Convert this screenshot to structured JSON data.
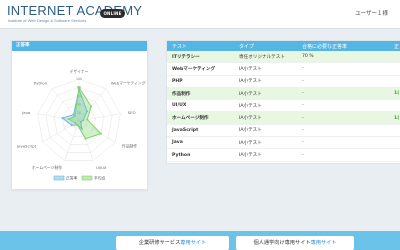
{
  "header": {
    "brand_title": "INTERNET ACADEMY",
    "brand_subtitle": "Institute of Web Design & Software Services",
    "badge": "ONLINE",
    "user": "ユーザー１様"
  },
  "chart_card": {
    "title": "正答率",
    "legend": [
      {
        "label": "正答率",
        "color": "#6fb7e0"
      },
      {
        "label": "平均点",
        "color": "#7fd36a"
      }
    ]
  },
  "chart_data": {
    "type": "radar",
    "axes": [
      "デザイナー",
      "Webマーケティング",
      "SEO",
      "作品制作",
      "UI/UX",
      "ホームページ制作",
      "JavaScript",
      "Java",
      "Python"
    ],
    "ticks": [
      "100",
      "80",
      "60",
      "40",
      "20"
    ],
    "series": [
      {
        "name": "正答率",
        "color": "#6fb7e0",
        "values": [
          75,
          30,
          10,
          5,
          20,
          10,
          20,
          40,
          20
        ]
      },
      {
        "name": "平均点",
        "color": "#7fd36a",
        "values": [
          80,
          45,
          20,
          60,
          45,
          10,
          10,
          25,
          15
        ]
      }
    ]
  },
  "table": {
    "headers": [
      "テスト",
      "タイプ",
      "合格に必要な正答率",
      "正"
    ],
    "rows": [
      {
        "name": "ITリテラシー",
        "type": "専任オリジナルテスト",
        "required": "70 %",
        "extra": "",
        "highlight": true
      },
      {
        "name": "Webマーケティング",
        "type": "IA小テスト",
        "required": "-",
        "extra": "",
        "highlight": false
      },
      {
        "name": "PHP",
        "type": "IA小テスト",
        "required": "-",
        "extra": "",
        "highlight": false
      },
      {
        "name": "作品制作",
        "type": "IA小テスト",
        "required": "-",
        "extra": "1(",
        "highlight": true
      },
      {
        "name": "UI/UX",
        "type": "IA小テスト",
        "required": "-",
        "extra": "",
        "highlight": false
      },
      {
        "name": "ホームページ制作",
        "type": "IA小テスト",
        "required": "-",
        "extra": "1(",
        "highlight": true
      },
      {
        "name": "JavaScript",
        "type": "IA小テスト",
        "required": "-",
        "extra": "",
        "highlight": false
      },
      {
        "name": "Java",
        "type": "IA小テスト",
        "required": "-",
        "extra": "",
        "highlight": false
      },
      {
        "name": "Python",
        "type": "IA小テスト",
        "required": "-",
        "extra": "",
        "highlight": false
      }
    ]
  },
  "footer": {
    "left_prefix": "企業研修サービス",
    "left_link": "専用サイト",
    "right_prefix": "個人通学向け専用サイト",
    "right_link": "専用サイト"
  }
}
